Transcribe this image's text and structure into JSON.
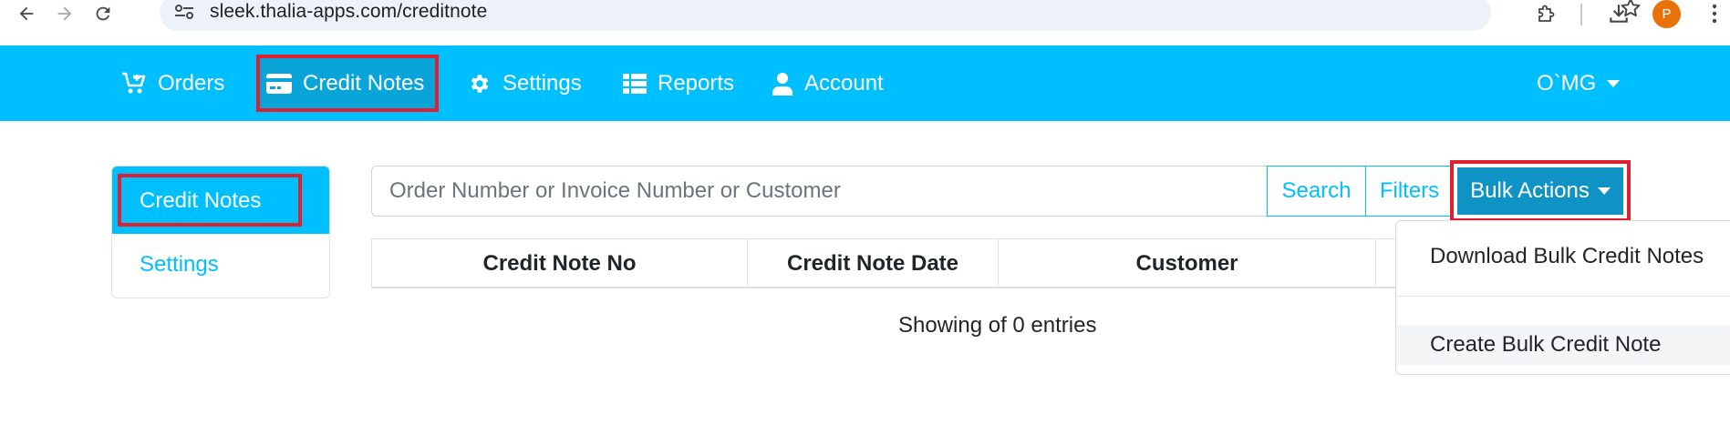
{
  "browser": {
    "url": "sleek.thalia-apps.com/creditnote",
    "avatar_letter": "P"
  },
  "navbar": {
    "items": [
      {
        "label": "Orders",
        "icon": "cart-plus-icon"
      },
      {
        "label": "Credit Notes",
        "icon": "credit-card-icon",
        "active": true
      },
      {
        "label": "Settings",
        "icon": "gear-icon"
      },
      {
        "label": "Reports",
        "icon": "table-list-icon"
      },
      {
        "label": "Account",
        "icon": "user-icon"
      }
    ],
    "user_menu": "O`MG"
  },
  "sidebar": {
    "items": [
      {
        "label": "Credit Notes",
        "active": true
      },
      {
        "label": "Settings"
      }
    ]
  },
  "search": {
    "placeholder": "Order Number or Invoice Number or Customer",
    "search_label": "Search",
    "filters_label": "Filters",
    "bulk_actions_label": "Bulk Actions"
  },
  "table": {
    "columns": [
      "Credit Note No",
      "Credit Note Date",
      "Customer"
    ],
    "entries_text": "Showing of 0 entries"
  },
  "dropdown": {
    "items": [
      "Download Bulk Credit Notes",
      "Create Bulk Credit Note"
    ]
  },
  "colors": {
    "brand": "#00bfff",
    "highlight": "#e0202f",
    "bulk_button": "#0e93c4"
  }
}
